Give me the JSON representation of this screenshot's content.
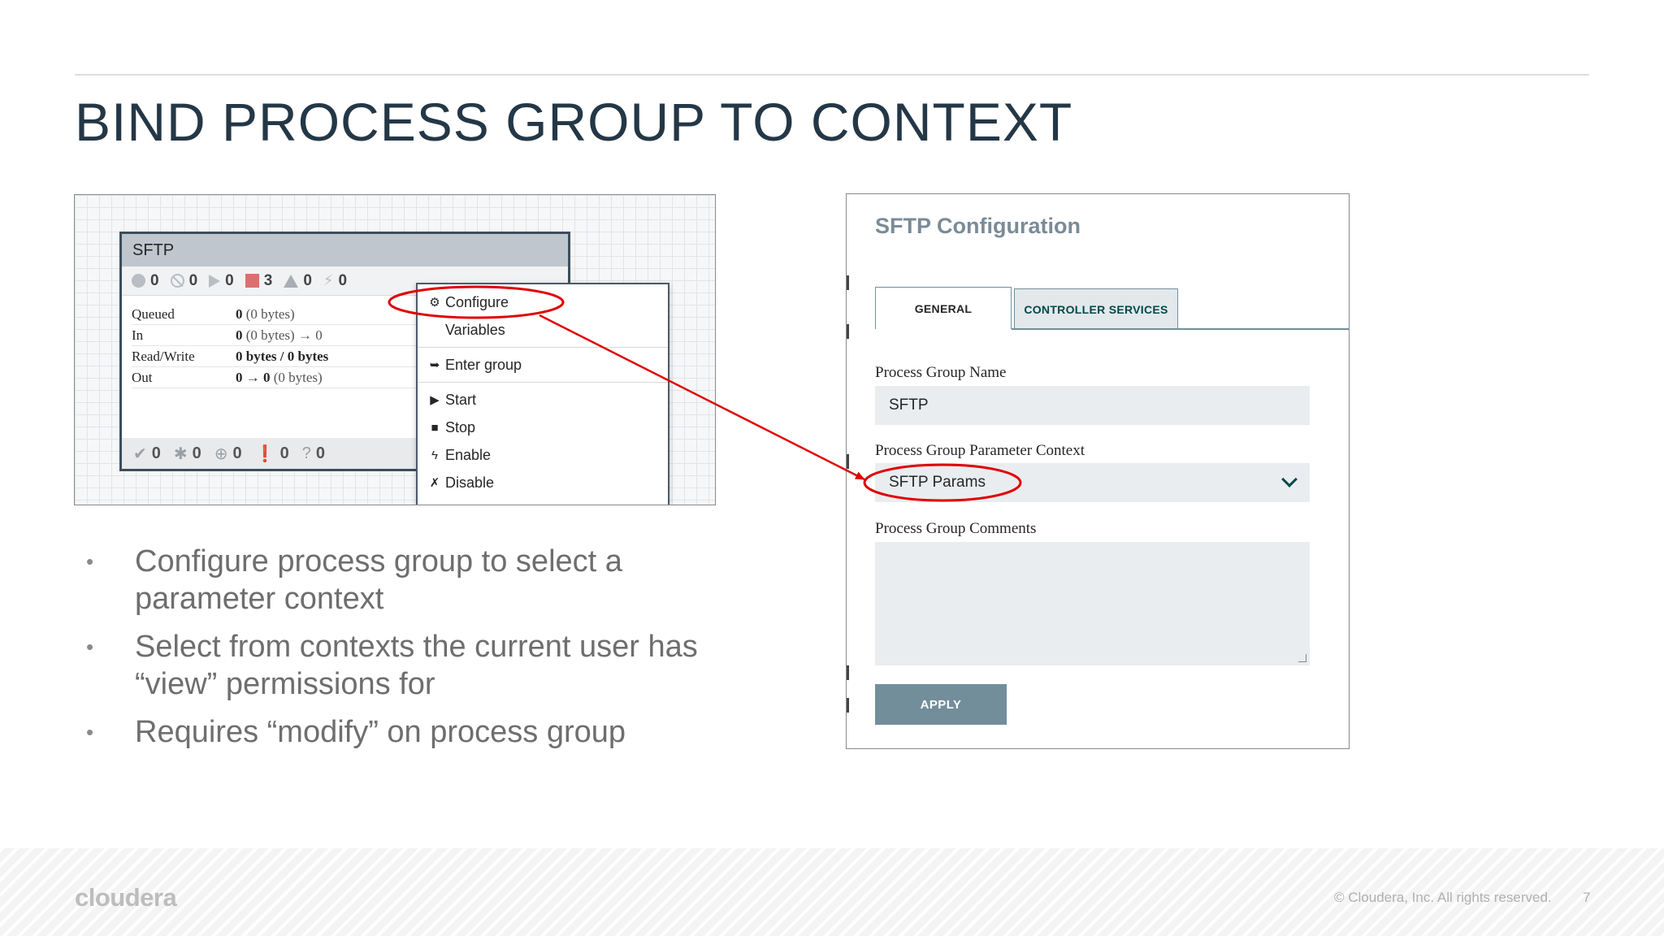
{
  "slide": {
    "title": "BIND PROCESS GROUP TO CONTEXT",
    "bullets": [
      "Configure process group to select a parameter context",
      "Select from contexts the current user has “view” permissions for",
      "Requires “modify” on process group"
    ],
    "footer": {
      "logo": "cloudera",
      "copyright": "© Cloudera, Inc. All rights reserved.",
      "page_number": "7"
    }
  },
  "process_group": {
    "name": "SFTP",
    "stats": [
      {
        "icon": "transmitting-icon",
        "value": "0"
      },
      {
        "icon": "not-transmitting-icon",
        "value": "0"
      },
      {
        "icon": "running-icon",
        "value": "0"
      },
      {
        "icon": "stopped-icon",
        "value": "3"
      },
      {
        "icon": "invalid-icon",
        "value": "0"
      },
      {
        "icon": "disabled-icon",
        "value": "0"
      }
    ],
    "rows": [
      {
        "label": "Queued",
        "bold": "0",
        "rest": " (0 bytes)"
      },
      {
        "label": "In",
        "bold": "0",
        "rest": " (0 bytes) → 0"
      },
      {
        "label": "Read/Write",
        "bold": "0 bytes / 0 bytes",
        "rest": ""
      },
      {
        "label": "Out",
        "bold": "0 → 0",
        "rest": " (0 bytes)"
      }
    ],
    "footer_stats": [
      {
        "icon": "up-to-date-icon",
        "glyph": "✔",
        "value": "0"
      },
      {
        "icon": "locally-modified-icon",
        "glyph": "✱",
        "value": "0"
      },
      {
        "icon": "stale-icon",
        "glyph": "⊕",
        "value": "0"
      },
      {
        "icon": "sync-failure-icon",
        "glyph": "❗",
        "value": "0"
      },
      {
        "icon": "unknown-icon",
        "glyph": "?",
        "value": "0"
      }
    ]
  },
  "context_menu": {
    "items": [
      {
        "icon": "gear-icon",
        "glyph": "⚙",
        "label": "Configure"
      },
      {
        "icon": "",
        "glyph": "",
        "label": "Variables"
      },
      {
        "icon": "enter-group-icon",
        "glyph": "➥",
        "label": "Enter group"
      },
      {
        "icon": "play-icon",
        "glyph": "▶",
        "label": "Start"
      },
      {
        "icon": "stop-icon",
        "glyph": "■",
        "label": "Stop"
      },
      {
        "icon": "enable-icon",
        "glyph": "ϟ",
        "label": "Enable"
      },
      {
        "icon": "disable-icon",
        "glyph": "✗",
        "label": "Disable"
      }
    ]
  },
  "config_dialog": {
    "title": "SFTP Configuration",
    "tabs": {
      "general": "GENERAL",
      "controller_services": "CONTROLLER SERVICES"
    },
    "name_label": "Process Group Name",
    "name_value": "SFTP",
    "context_label": "Process Group Parameter Context",
    "context_value": "SFTP Params",
    "comments_label": "Process Group Comments",
    "comments_value": "",
    "apply_label": "APPLY"
  },
  "colors": {
    "title": "#243746",
    "annotation": "#e00000",
    "dialog_accent": "#728e9b",
    "tab_text": "#004849"
  }
}
